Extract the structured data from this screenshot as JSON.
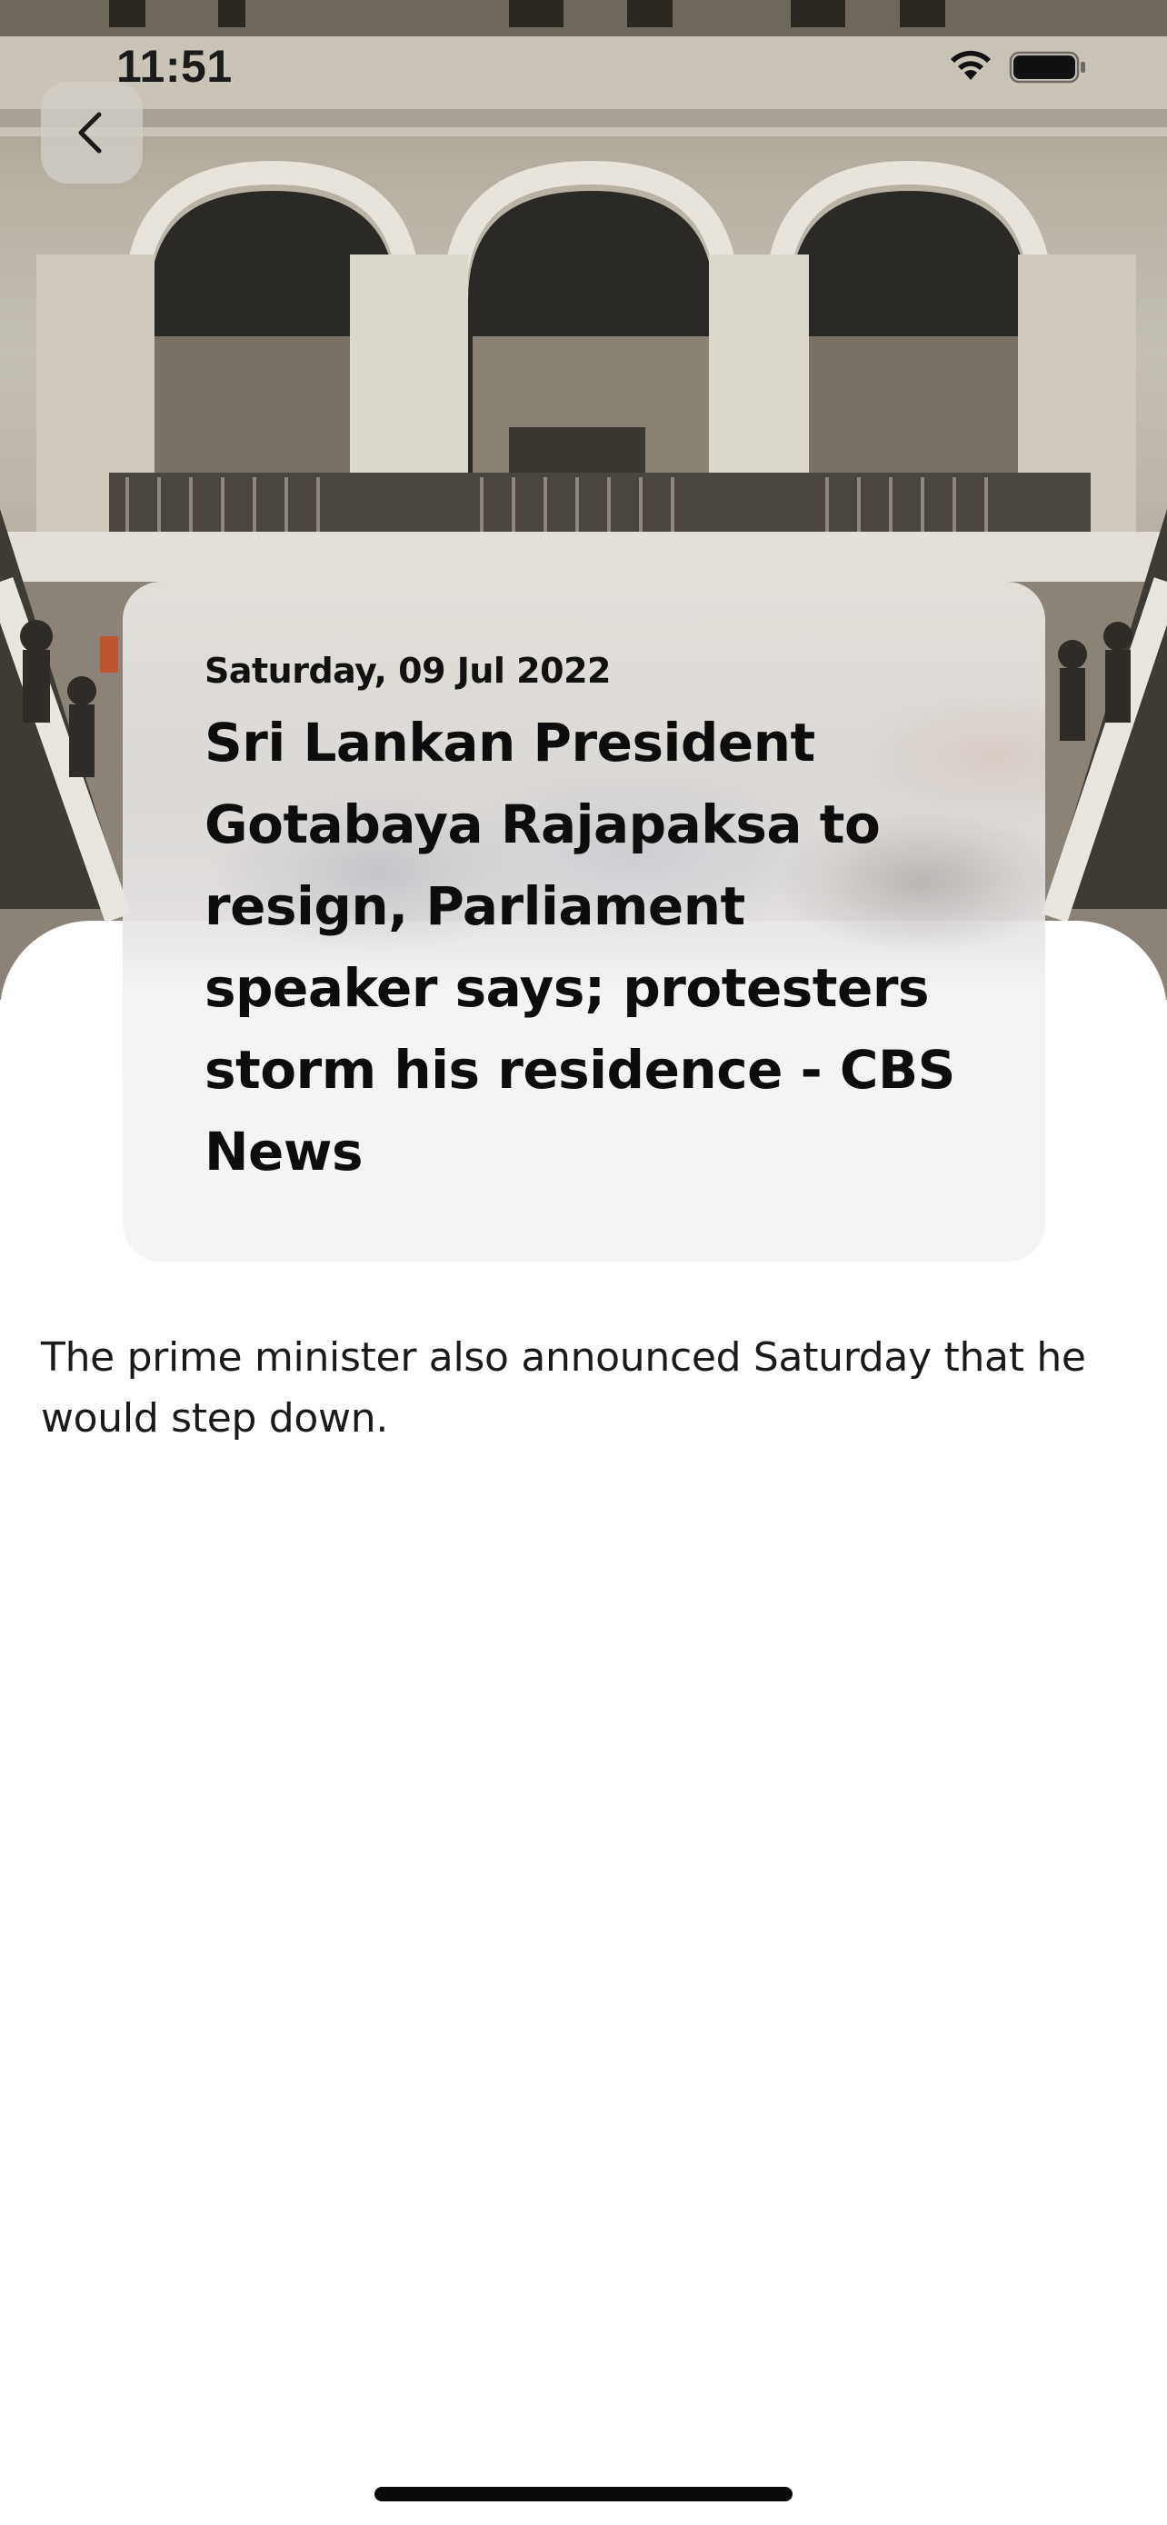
{
  "status_bar": {
    "time": "11:51",
    "icons": [
      "wifi-icon",
      "battery-icon"
    ]
  },
  "hero": {
    "description_icon": "building-interior-photo"
  },
  "navigation": {
    "back_icon": "chevron-left-icon"
  },
  "article": {
    "date": "Saturday, 09 Jul 2022",
    "title": "Sri Lankan President Gotabaya Rajapaksa to resign, Parliament speaker says; protesters storm his residence - CBS News",
    "body": "The prime minister also announced Saturday that he would step down."
  },
  "colors": {
    "card_background": "#f4f4f4",
    "text": "#111111",
    "sheet": "#ffffff"
  }
}
